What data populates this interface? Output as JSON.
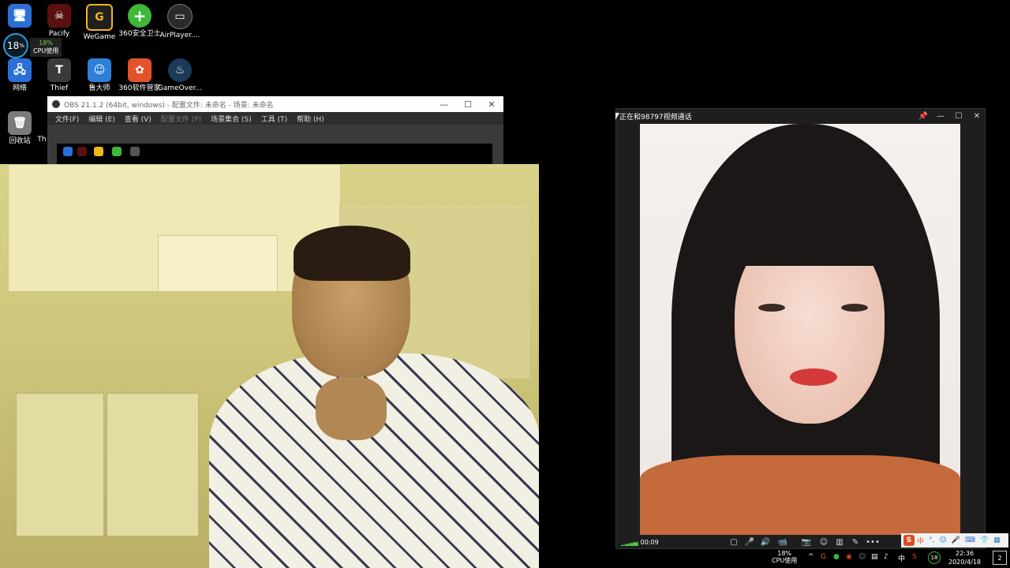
{
  "desktop_icons": [
    {
      "label": "",
      "glyph": "🖥",
      "color": "#2b6fd6"
    },
    {
      "label": "Pacify",
      "glyph": "☠",
      "color": "#5a1010"
    },
    {
      "label": "WeGame",
      "glyph": "G",
      "color": "#1f1f1f"
    },
    {
      "label": "360安全卫士",
      "glyph": "+",
      "color": "#3fb83a"
    },
    {
      "label": "AirPlayer....",
      "glyph": "▭",
      "color": "#2a2a2a"
    },
    {
      "label": "网络",
      "glyph": "🖧",
      "color": "#2b6fd6"
    },
    {
      "label": "Thief",
      "glyph": "T",
      "color": "#3a3a3a"
    },
    {
      "label": "鲁大师",
      "glyph": "☺",
      "color": "#2d7fd8"
    },
    {
      "label": "360软件管家",
      "glyph": "✿",
      "color": "#e3522b"
    },
    {
      "label": "GameOver...",
      "glyph": "♨",
      "color": "#1b3a5a"
    },
    {
      "label": "回收站",
      "glyph": "🗑",
      "color": "#7a7a7a"
    },
    {
      "label": "Th",
      "glyph": "",
      "color": "#000000"
    }
  ],
  "cpu_widget": {
    "value": "18",
    "unit": "%",
    "pop_pct": "18%",
    "pop_label": "CPU使用"
  },
  "obs": {
    "title": "OBS 21.1.2 (64bit, windows) - 配置文件: 未命名 - 场景: 未命名",
    "menu": [
      "文件(F)",
      "编辑 (E)",
      "查看 (V)",
      "配置文件 (P)",
      "场景集合 (S)",
      "工具 (T)",
      "帮助 (H)"
    ],
    "controls": {
      "minimize": "—",
      "maximize": "☐",
      "close": "✕"
    }
  },
  "video_call": {
    "title": "正在和98797视频通话",
    "controls": {
      "pin": "📌",
      "minimize": "—",
      "maximize": "☐",
      "close": "✕"
    },
    "timer": "00:09",
    "toolbar": [
      "▢",
      "🎤",
      "🔊",
      "📹",
      "📷",
      "☺",
      "▥",
      "✎",
      "•••"
    ]
  },
  "tray": {
    "cpu_pct": "18%",
    "cpu_label": "CPU使用",
    "lang": "中",
    "time": "22:36",
    "date": "2020/4/18",
    "notifications": "2",
    "badge": "18"
  },
  "ime": {
    "logo": "S",
    "mode": "中",
    "items": [
      "°,",
      "☺",
      "🎤",
      "⌨",
      "👕",
      "▦"
    ]
  }
}
